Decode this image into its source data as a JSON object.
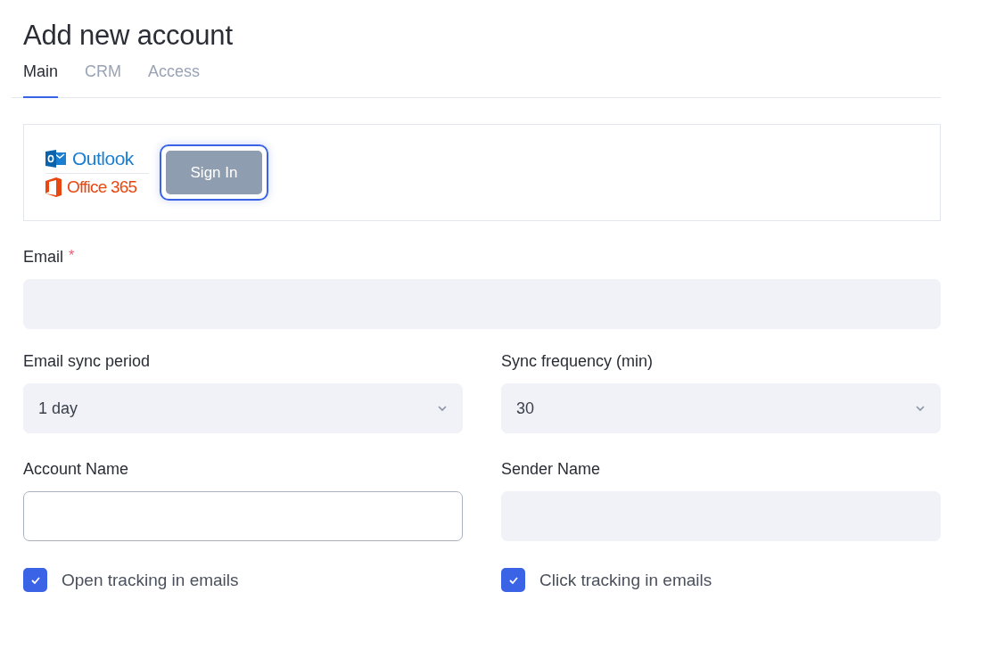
{
  "title": "Add new account",
  "tabs": [
    {
      "label": "Main",
      "selected": true
    },
    {
      "label": "CRM",
      "selected": false
    },
    {
      "label": "Access",
      "selected": false
    }
  ],
  "provider": {
    "outlook_label": "Outlook",
    "office_label": "Office 365",
    "sign_in": "Sign In",
    "focused": true
  },
  "email": {
    "label": "Email",
    "required_mark": "*",
    "focused": false
  },
  "rows": [
    {
      "kind": "select",
      "label": "Email sync period",
      "value": "1 day"
    },
    {
      "kind": "select",
      "label": "Sync frequency (min)",
      "value": "30"
    },
    {
      "kind": "text",
      "label": "Account Name",
      "focused": true
    },
    {
      "kind": "text",
      "label": "Sender Name",
      "focused": false
    },
    {
      "kind": "checkbox",
      "label": "Open tracking in emails",
      "checked": true
    },
    {
      "kind": "checkbox",
      "label": "Click tracking in emails",
      "checked": true
    }
  ]
}
